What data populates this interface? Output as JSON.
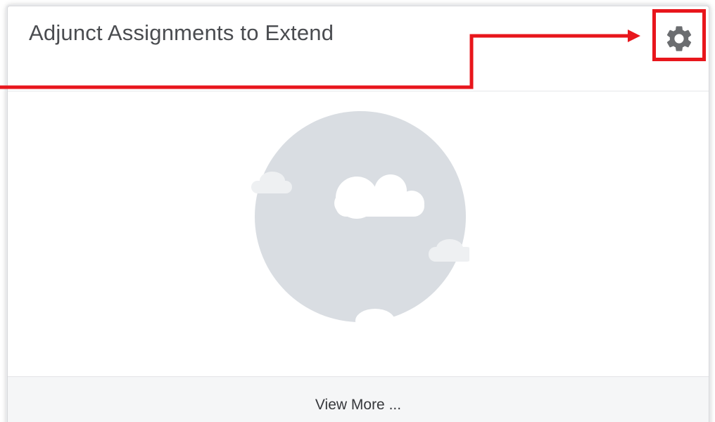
{
  "card": {
    "title": "Adjunct Assignments to Extend",
    "settings_icon": "gear-icon",
    "empty_state_icon": "cloud-illustration",
    "footer": {
      "view_more_label": "View More ..."
    }
  },
  "colors": {
    "title_text": "#4a4c50",
    "gear": "#6b6d70",
    "illustration_circle": "#d9dde2",
    "annotation_red": "#e8161c",
    "footer_bg": "#f5f6f7"
  }
}
